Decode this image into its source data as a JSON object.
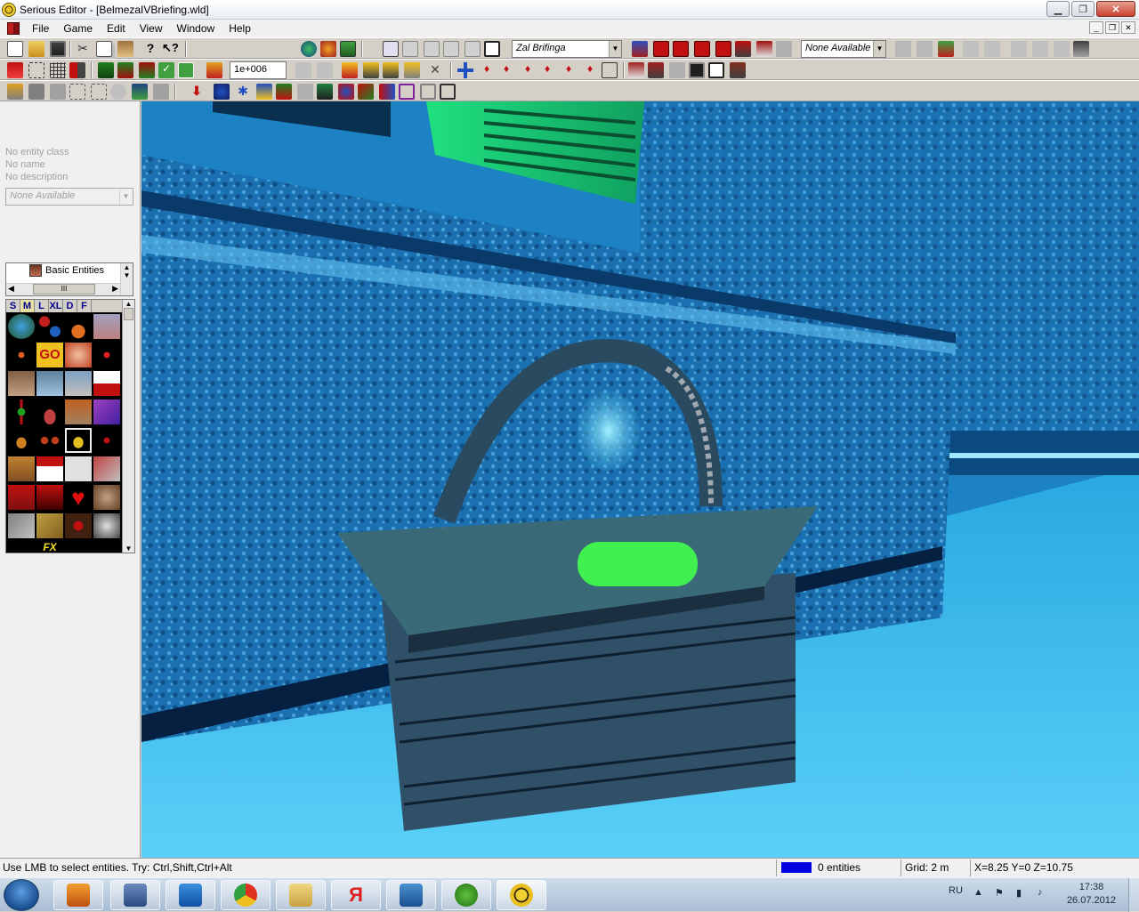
{
  "window": {
    "title": "Serious Editor - [BelmezaIVBriefing.wld]"
  },
  "menubar": {
    "items": [
      "File",
      "Game",
      "Edit",
      "View",
      "Window",
      "Help"
    ]
  },
  "toolbar": {
    "world_combo": "Zal Brifinga",
    "browse_combo": "None Available",
    "number_field": "1e+006"
  },
  "left_panel": {
    "entity_class": "No entity class",
    "entity_name": "No name",
    "entity_description": "No description",
    "entity_combo": "None Available",
    "tree_node": "Basic Entities",
    "palette_tabs": [
      "S",
      "M",
      "L",
      "XL",
      "D",
      "F"
    ],
    "palette_selected_tab": "M",
    "palette_label_go": "GO",
    "palette_label_fx": "FX",
    "tree_scroll_mark": "III"
  },
  "statusbar": {
    "hint": "Use LMB to select entities. Try: Ctrl,Shift,Ctrl+Alt",
    "entities": "0 entities",
    "grid": "Grid: 2 m",
    "coords": "X=8.25 Y=0 Z=10.75"
  },
  "taskbar": {
    "language": "RU",
    "time": "17:38",
    "date": "26.07.2012",
    "apps": [
      "media-player",
      "virtualbox",
      "teamviewer",
      "chrome",
      "explorer",
      "yandex-browser",
      "mail",
      "utorrent",
      "serious-editor"
    ]
  },
  "colors": {
    "viewport_bg": "#0a3a60",
    "wall": "#1a78b8",
    "floor": "#30c0f0",
    "hologram_green": "#40f050",
    "grid_indicator": "#0000e0"
  }
}
